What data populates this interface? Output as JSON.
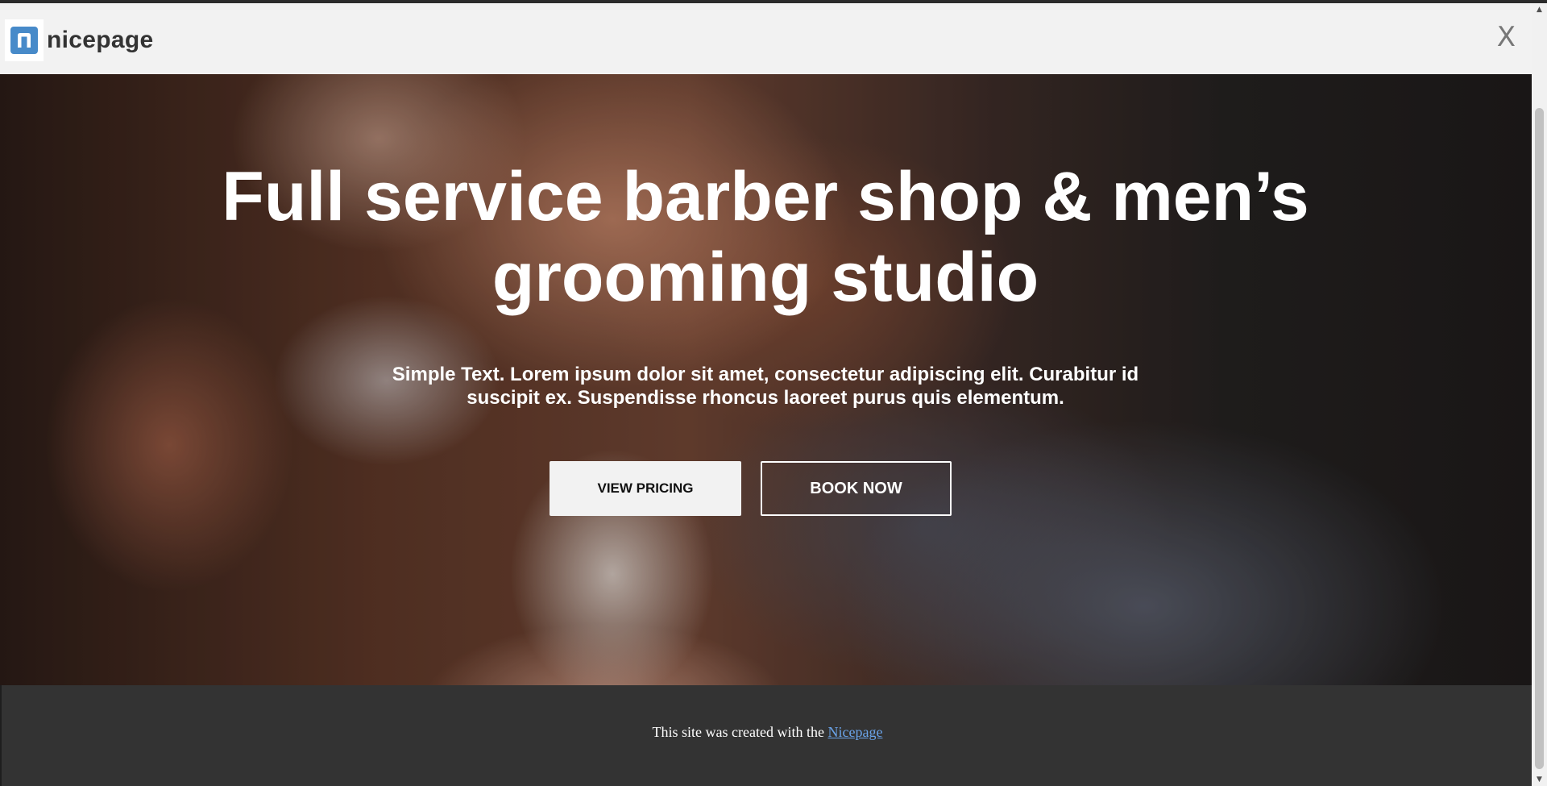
{
  "header": {
    "logo_text": "nicepage",
    "logo_icon": "nicepage-logo-icon",
    "close_label": "X"
  },
  "hero": {
    "title": "Full service barber shop & men’s grooming studio",
    "text": "Simple Text. Lorem ipsum dolor sit amet, consectetur adipiscing elit. Curabitur id suscipit ex. Suspendisse rhoncus laoreet purus quis elementum.",
    "buttons": {
      "pricing_label": "VIEW PRICING",
      "book_label": "BOOK NOW"
    }
  },
  "footer": {
    "text_prefix": "This site was created with the ",
    "link_label": "Nicepage"
  },
  "colors": {
    "brand_blue": "#478ac9",
    "header_bg": "#f2f2f2",
    "footer_bg": "#333333",
    "link": "#6aa3e8"
  }
}
